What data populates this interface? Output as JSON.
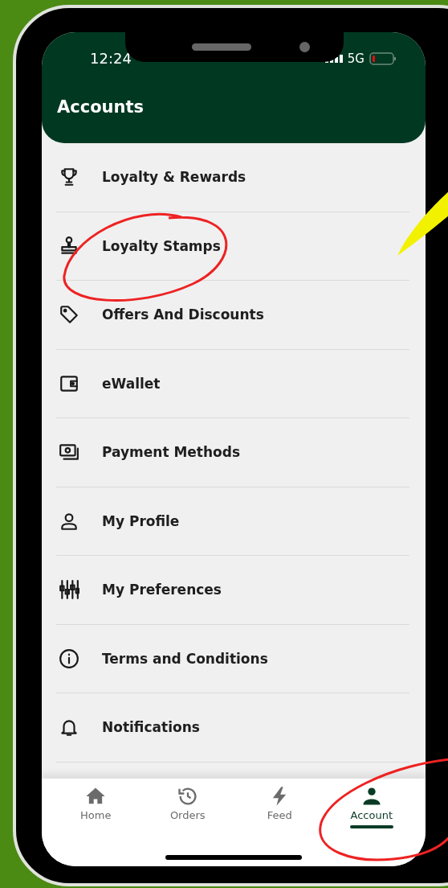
{
  "status_bar": {
    "time": "12:24",
    "network": "5G"
  },
  "header": {
    "title": "Accounts"
  },
  "menu": [
    {
      "label": "Loyalty & Rewards"
    },
    {
      "label": "Loyalty Stamps"
    },
    {
      "label": "Offers And Discounts"
    },
    {
      "label": "eWallet"
    },
    {
      "label": "Payment Methods"
    },
    {
      "label": "My Profile"
    },
    {
      "label": "My Preferences"
    },
    {
      "label": "Terms and Conditions"
    },
    {
      "label": "Notifications"
    }
  ],
  "tab_bar": [
    {
      "label": "Home",
      "selected": false
    },
    {
      "label": "Orders",
      "selected": false
    },
    {
      "label": "Feed",
      "selected": false
    },
    {
      "label": "Account",
      "selected": true
    }
  ]
}
